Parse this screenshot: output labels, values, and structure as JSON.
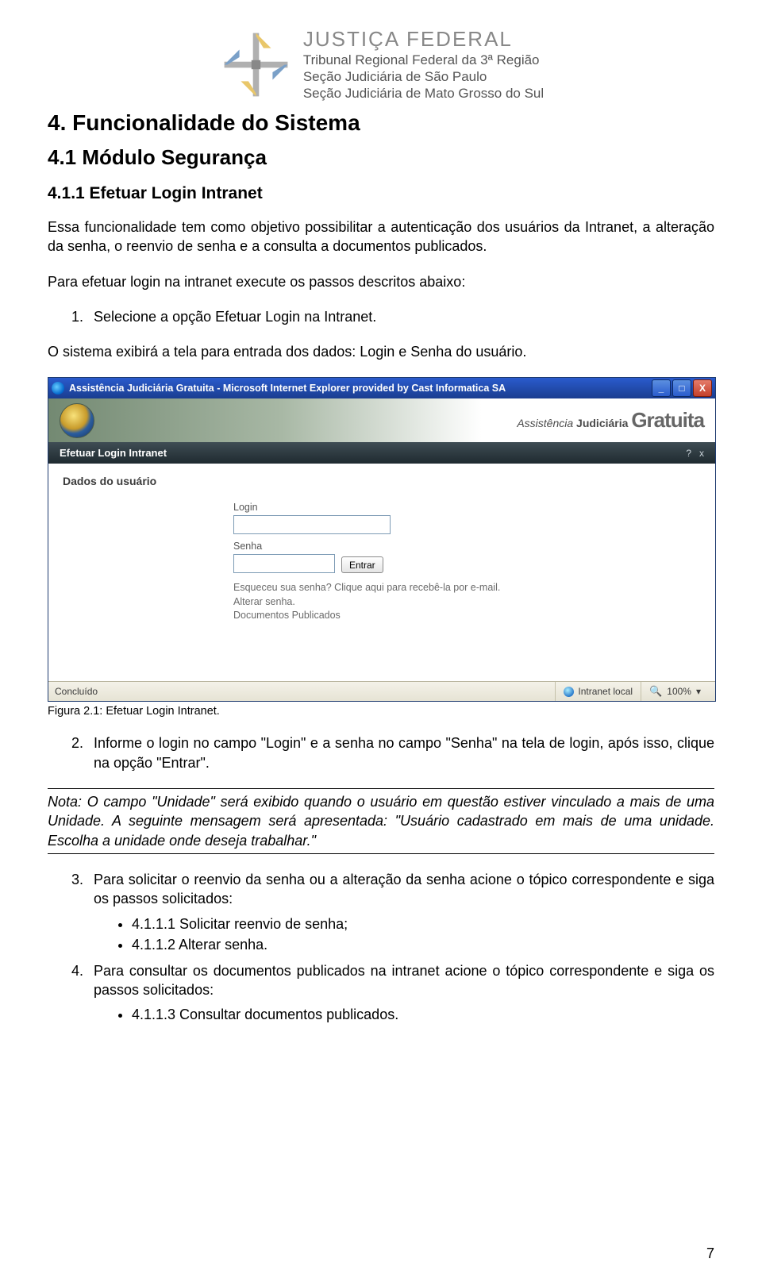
{
  "header": {
    "line1": "JUSTIÇA FEDERAL",
    "line2": "Tribunal Regional Federal da 3ª Região",
    "line3": "Seção Judiciária de São Paulo",
    "line4": "Seção Judiciária de Mato Grosso do Sul"
  },
  "h1": "4.   Funcionalidade do Sistema",
  "h2": "4.1    Módulo Segurança",
  "h3": "4.1.1 Efetuar Login Intranet",
  "intro": "Essa funcionalidade tem como objetivo possibilitar a autenticação dos usuários da Intranet, a alteração da senha, o reenvio de senha e a consulta a documentos publicados.",
  "para2": "Para efetuar login na intranet execute os passos descritos abaixo:",
  "step1": "Selecione a opção Efetuar Login na Intranet.",
  "para3": "O sistema exibirá a tela para entrada dos dados: Login e Senha do usuário.",
  "caption": "Figura 2.1: Efetuar Login Intranet.",
  "step2": "Informe o login no campo \"Login\" e a senha no campo \"Senha\" na tela de login, após isso, clique na opção \"Entrar\".",
  "note": "Nota: O campo \"Unidade\" será exibido quando o usuário em questão estiver vinculado a mais de uma Unidade.  A seguinte mensagem será apresentada: \"Usuário cadastrado em mais de uma unidade. Escolha a unidade onde deseja trabalhar.\"",
  "step3": "Para solicitar o reenvio da senha ou a alteração da senha acione o tópico correspondente e siga os passos solicitados:",
  "step3_b1": "4.1.1.1 Solicitar reenvio de senha;",
  "step3_b2": "4.1.1.2 Alterar senha.",
  "step4": "Para consultar os documentos publicados na intranet acione o tópico correspondente e siga os passos solicitados:",
  "step4_b1": "4.1.1.3 Consultar documentos publicados.",
  "page_number": "7",
  "screenshot": {
    "window_title": "Assistência Judiciária Gratuita - Microsoft Internet Explorer provided by Cast Informatica SA",
    "banner_assist": "Assistência",
    "banner_jud": " Judiciária ",
    "banner_grat": "Gratuita",
    "subbar_title": "Efetuar Login Intranet",
    "help_icon": "?",
    "close_icon": "x",
    "section_label": "Dados do usuário",
    "login_label": "Login",
    "senha_label": "Senha",
    "entrar_label": "Entrar",
    "forgot_line": "Esqueceu sua senha? Clique aqui para recebê-la por e-mail.",
    "alterar_line": "Alterar senha.",
    "docs_line": "Documentos Publicados",
    "status_done": "Concluído",
    "status_zone": "Intranet local",
    "status_zoom": "100%"
  }
}
